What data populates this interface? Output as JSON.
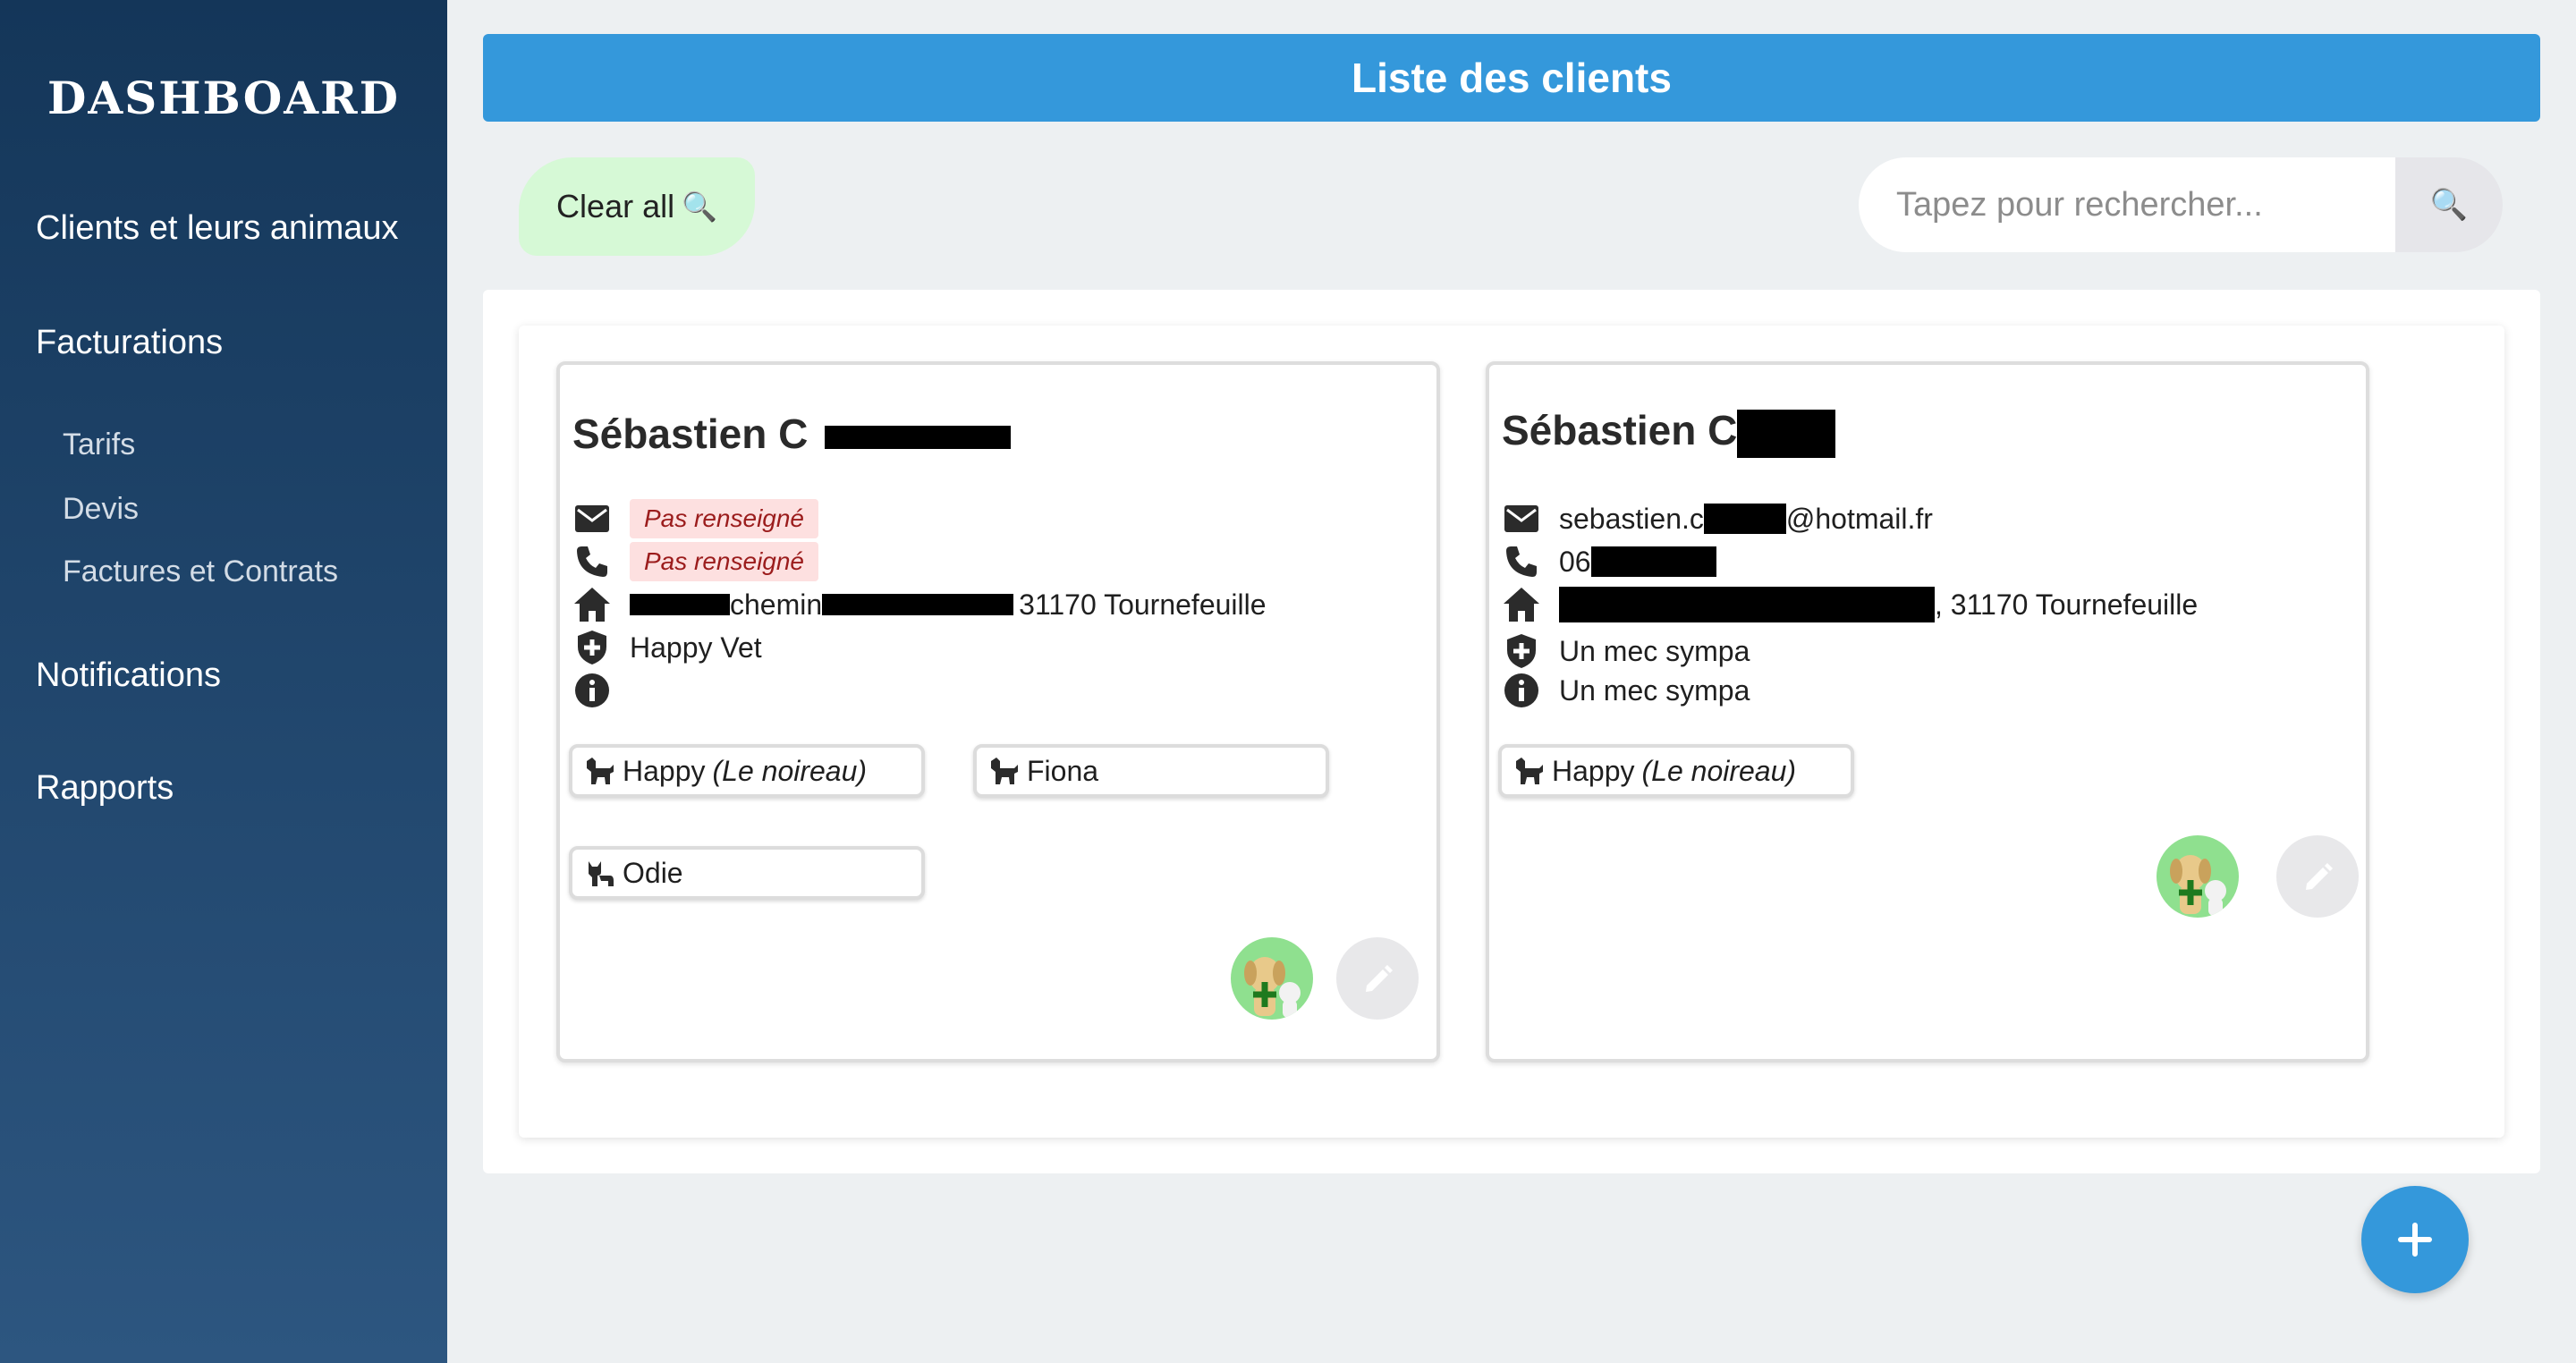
{
  "sidebar": {
    "brand": "DASHBOARD",
    "items": [
      {
        "label": "Clients et leurs animaux"
      },
      {
        "label": "Facturations"
      },
      {
        "label": "Tarifs"
      },
      {
        "label": "Devis"
      },
      {
        "label": "Factures et Contrats"
      },
      {
        "label": "Notifications"
      },
      {
        "label": "Rapports"
      }
    ]
  },
  "header": {
    "title": "Liste des clients"
  },
  "toolbar": {
    "clear_label": "Clear all",
    "clear_icon": "🔍",
    "search_placeholder": "Tapez pour rechercher...",
    "search_icon": "🔍"
  },
  "clients": [
    {
      "name": "Sébastien C",
      "email": "Pas renseigné",
      "phone": "Pas renseigné",
      "address_mid": "chemin",
      "address_end": "31170 Tournefeuille",
      "vet": "Happy Vet",
      "info": "",
      "pets": [
        {
          "name": "Happy",
          "nickname": "(Le noireau)",
          "species": "dog"
        },
        {
          "name": "Fiona",
          "nickname": "",
          "species": "dog"
        },
        {
          "name": "Odie",
          "nickname": "",
          "species": "cat"
        }
      ]
    },
    {
      "name": "Sébastien C",
      "email_start": "sebastien.c",
      "email_end": "@hotmail.fr",
      "phone_start": "06",
      "address_end": ", 31170 Tournefeuille",
      "vet": "Un mec sympa",
      "info": "Un mec sympa",
      "pets": [
        {
          "name": "Happy",
          "nickname": "(Le noireau)",
          "species": "dog"
        }
      ]
    }
  ],
  "colors": {
    "accent": "#3498db",
    "sidebar_top": "#143659",
    "sidebar_bottom": "#2d5680",
    "clear_bg": "#d6f9d6",
    "missing_bg": "#fde0e0",
    "missing_text": "#9b1c1c",
    "vet_avatar_bg": "#8fe08f"
  }
}
